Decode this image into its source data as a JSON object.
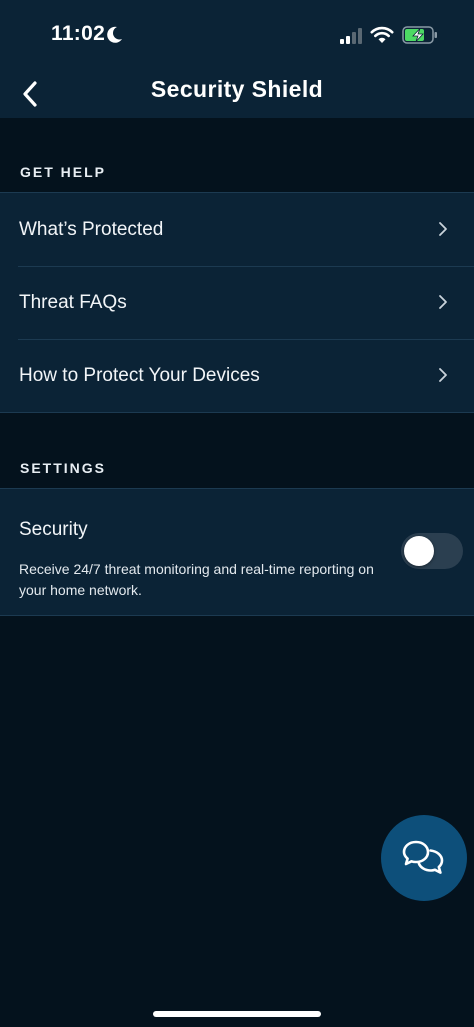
{
  "status_bar": {
    "time": "11:02",
    "icons": [
      "moon-icon",
      "signal-icon",
      "wifi-icon",
      "battery-charging-icon"
    ]
  },
  "header": {
    "title": "Security Shield",
    "back_icon": "chevron-left-icon"
  },
  "help_section": {
    "header": "GET HELP",
    "items": [
      {
        "label": "What’s Protected"
      },
      {
        "label": "Threat FAQs"
      },
      {
        "label": "How to Protect Your Devices"
      }
    ]
  },
  "settings_section": {
    "header": "SETTINGS",
    "security": {
      "title": "Security",
      "description": "Receive 24/7 threat monitoring and real-time reporting on your home network.",
      "enabled": false
    }
  },
  "chat_button": {
    "icon": "chat-bubbles-icon"
  },
  "colors": {
    "background": "#04121d",
    "surface": "#0b2336",
    "divider": "#1c3a51",
    "accent": "#0d4f7a",
    "toggle_off": "#2b3f50",
    "battery_green": "#4cd964"
  }
}
